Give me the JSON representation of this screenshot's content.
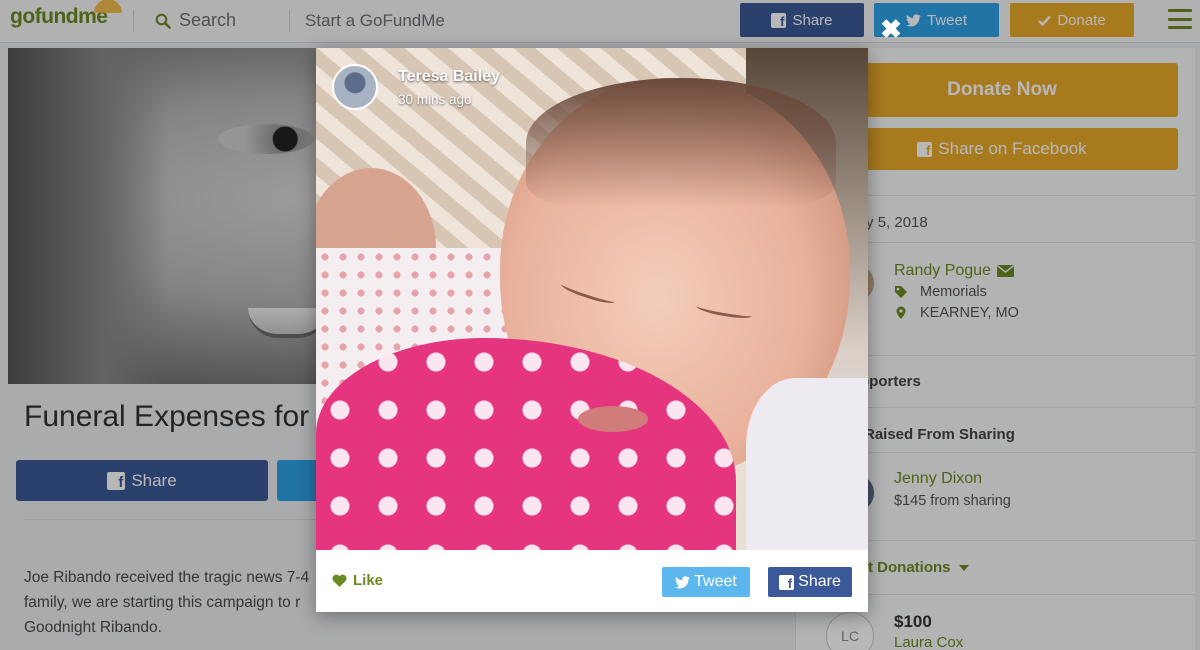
{
  "nav": {
    "logo": "gofundme",
    "search_label": "Search",
    "start_label": "Start a GoFundMe",
    "share_label": "Share",
    "tweet_label": "Tweet",
    "donate_label": "Donate"
  },
  "campaign": {
    "title": "Funeral Expenses for Ri",
    "share_label": "Share",
    "story_lines": [
      "Joe Ribando received the tragic news 7-4",
      "family, we are starting this campaign to r",
      "Goodnight Ribando."
    ]
  },
  "sidebar": {
    "donate_now_label": "Donate Now",
    "share_facebook_label": "Share on Facebook",
    "created": "ed July 5, 2018",
    "organizer": {
      "name": "Randy Pogue",
      "category": "Memorials",
      "location": "KEARNEY, MO"
    },
    "supporters_label": "pporters",
    "raised_sharing_label": "Raised From Sharing",
    "top_sharer": {
      "name": "Jenny Dixon",
      "amount": "$145 from sharing"
    },
    "recent_donations_label": "t Donations",
    "donation": {
      "initials": "LC",
      "amount": "$100",
      "name": "Laura Cox"
    }
  },
  "modal": {
    "close_symbol": "✖",
    "poster_name": "Teresa Bailey",
    "poster_time": "30 mins ago",
    "like_label": "Like",
    "tweet_label": "Tweet",
    "share_label": "Share"
  },
  "colors": {
    "brand_green": "#6c8a23",
    "facebook_blue": "#3b5998",
    "twitter_blue": "#2ea1e6",
    "donate_gold": "#e8a92a"
  },
  "icons": [
    "search-icon",
    "facebook-icon",
    "twitter-icon",
    "check-icon",
    "hamburger-icon",
    "envelope-icon",
    "tag-icon",
    "map-pin-icon",
    "caret-down-icon",
    "heart-icon",
    "close-icon"
  ]
}
